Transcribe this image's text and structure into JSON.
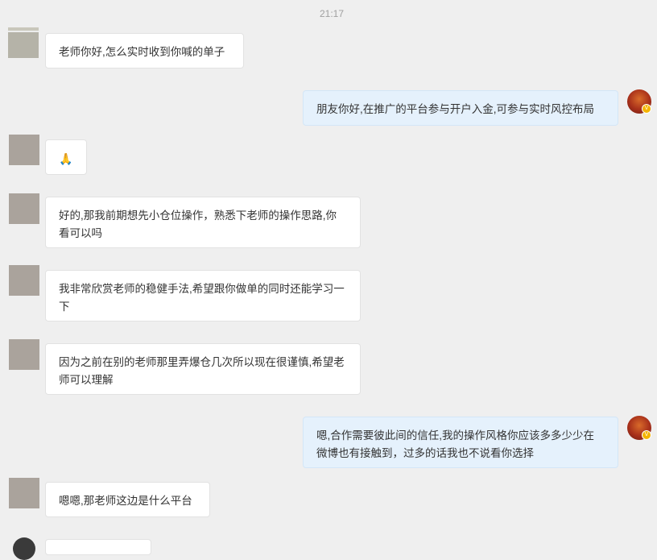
{
  "timestamp": "21:17",
  "messages": [
    {
      "side": "in",
      "text": "老师你好,怎么实时收到你喊的单子"
    },
    {
      "side": "out",
      "text": "朋友你好,在推广的平台参与开户入金,可参与实时风控布局"
    },
    {
      "side": "in",
      "text": "🙏"
    },
    {
      "side": "in",
      "text": "好的,那我前期想先小仓位操作，熟悉下老师的操作思路,你看可以吗"
    },
    {
      "side": "in",
      "text": "我非常欣赏老师的稳健手法,希望跟你做单的同时还能学习一下"
    },
    {
      "side": "in",
      "text": "因为之前在别的老师那里弄爆仓几次所以现在很谨慎,希望老师可以理解"
    },
    {
      "side": "out",
      "text": "嗯,合作需要彼此间的信任,我的操作风格你应该多多少少在微博也有接触到，过多的话我也不说看你选择"
    },
    {
      "side": "in",
      "text": "嗯嗯,那老师这边是什么平台"
    }
  ],
  "verified_badge": "V"
}
